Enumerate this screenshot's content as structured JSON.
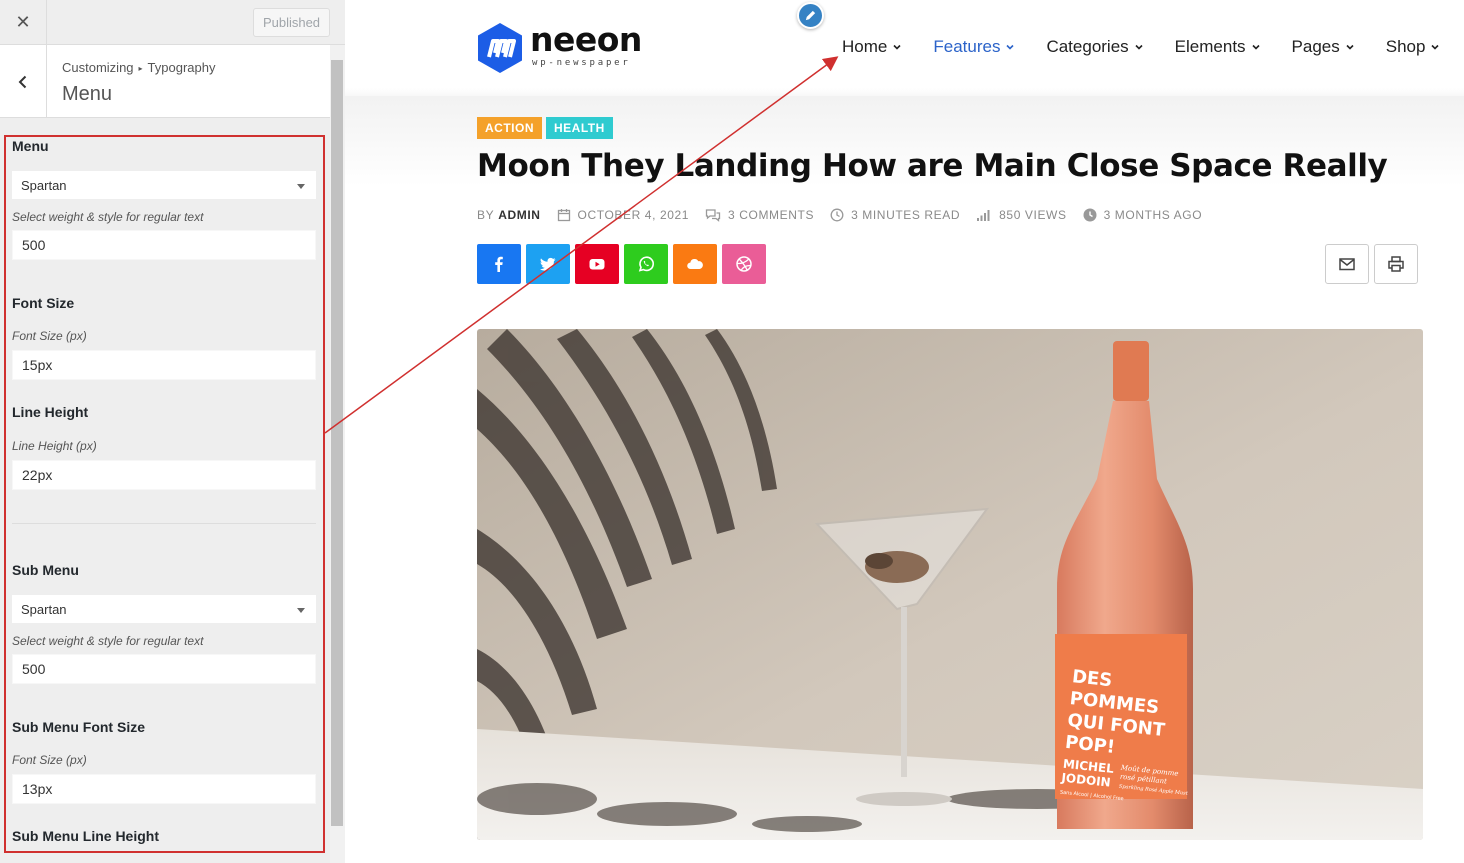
{
  "topbar": {
    "close_icon": "close-icon",
    "close_glyph": "✕",
    "published_label": "Published"
  },
  "section": {
    "breadcrumb_root": "Customizing",
    "breadcrumb_sep": "▸",
    "breadcrumb_parent": "Typography",
    "title": "Menu"
  },
  "menu_controls": {
    "menu_label": "Menu",
    "menu_font": "Spartan",
    "menu_weight_hint": "Select weight & style for regular text",
    "menu_weight": "500",
    "font_size_label": "Font Size",
    "font_size_hint": "Font Size (px)",
    "font_size_value": "15px",
    "line_height_label": "Line Height",
    "line_height_hint": "Line Height (px)",
    "line_height_value": "22px",
    "sub_menu_label": "Sub Menu",
    "sub_menu_font": "Spartan",
    "sub_menu_weight_hint": "Select weight & style for regular text",
    "sub_menu_weight": "500",
    "sub_font_size_label": "Sub Menu Font Size",
    "sub_font_size_hint": "Font Size (px)",
    "sub_font_size_value": "13px",
    "sub_line_height_label": "Sub Menu Line Height"
  },
  "site": {
    "logo_text": "neeon",
    "logo_tagline": "wp-newspaper",
    "nav": [
      {
        "label": "Home",
        "active": false
      },
      {
        "label": "Features",
        "active": true
      },
      {
        "label": "Categories",
        "active": false
      },
      {
        "label": "Elements",
        "active": false
      },
      {
        "label": "Pages",
        "active": false
      },
      {
        "label": "Shop",
        "active": false
      }
    ],
    "nav_active_color": "#2b63c9"
  },
  "post": {
    "tags": [
      {
        "label": "ACTION",
        "color": "#f4a12a"
      },
      {
        "label": "HEALTH",
        "color": "#2fcbd0"
      }
    ],
    "title": "Moon They Landing How are Main Close Space Really",
    "meta": {
      "by": "BY",
      "author": "ADMIN",
      "date": "OCTOBER 4, 2021",
      "comments": "3 COMMENTS",
      "read_time": "3 MINUTES READ",
      "views": "850 VIEWS",
      "ago": "3 MONTHS AGO"
    },
    "share": [
      {
        "name": "facebook-icon",
        "color": "#1877f2"
      },
      {
        "name": "twitter-icon",
        "color": "#1da1f2"
      },
      {
        "name": "youtube-icon",
        "color": "#e60023"
      },
      {
        "name": "whatsapp-icon",
        "color": "#2ecc1e"
      },
      {
        "name": "cloud-icon",
        "color": "#fa7a12"
      },
      {
        "name": "dribbble-icon",
        "color": "#ea5d97"
      }
    ],
    "tools": [
      "mail-icon",
      "print-icon"
    ],
    "hero_label_lines": [
      "DES",
      "POMMES",
      "QUI FONT",
      "POP!"
    ],
    "hero_label_small": [
      "MICHEL",
      "JODOIN"
    ],
    "hero_label_script": [
      "Moût de pomme",
      "rosé pétillant",
      "Sparkling Rosé Apple Must"
    ],
    "hero_label_footer": "Sans Alcool | Alcohol Free"
  },
  "annotation_color": "#d0302f"
}
